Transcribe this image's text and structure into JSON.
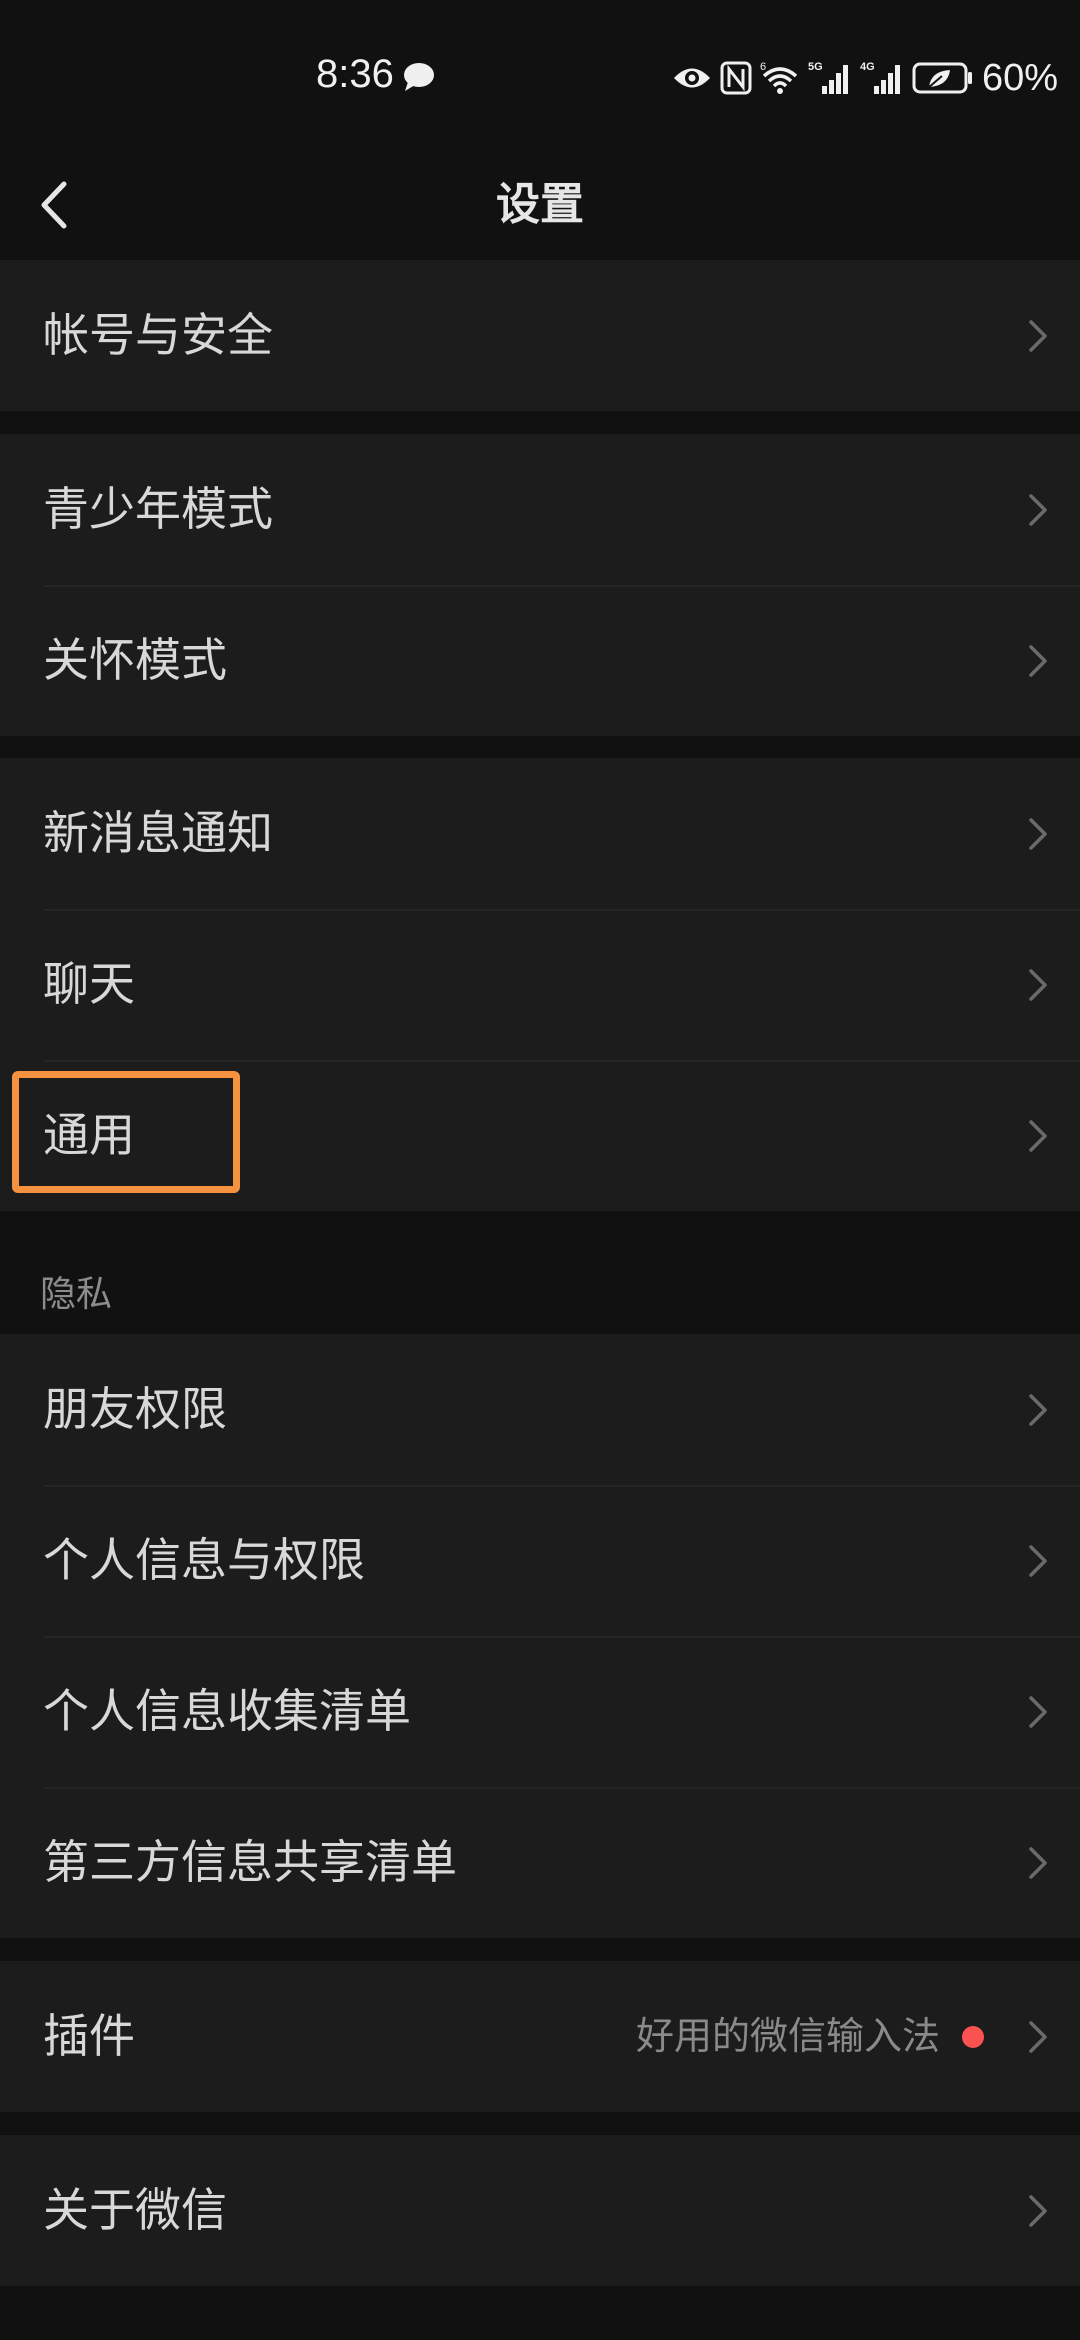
{
  "status_bar": {
    "time": "8:36",
    "battery": "60%",
    "network_1": "5G",
    "network_2": "4G",
    "wifi_label": "6"
  },
  "nav": {
    "title": "设置"
  },
  "groups": {
    "account": {
      "items": [
        {
          "label": "帐号与安全"
        }
      ]
    },
    "modes": {
      "items": [
        {
          "label": "青少年模式"
        },
        {
          "label": "关怀模式"
        }
      ]
    },
    "general": {
      "items": [
        {
          "label": "新消息通知"
        },
        {
          "label": "聊天"
        },
        {
          "label": "通用"
        }
      ]
    },
    "privacy": {
      "header": "隐私",
      "items": [
        {
          "label": "朋友权限"
        },
        {
          "label": "个人信息与权限"
        },
        {
          "label": "个人信息收集清单"
        },
        {
          "label": "第三方信息共享清单"
        }
      ]
    },
    "plugins": {
      "items": [
        {
          "label": "插件",
          "value": "好用的微信输入法"
        }
      ]
    },
    "about": {
      "items": [
        {
          "label": "关于微信"
        }
      ]
    }
  },
  "colors": {
    "background": "#111111",
    "row_background": "#1c1c1c",
    "highlight": "#f4923f",
    "red_dot": "#fa5151"
  }
}
